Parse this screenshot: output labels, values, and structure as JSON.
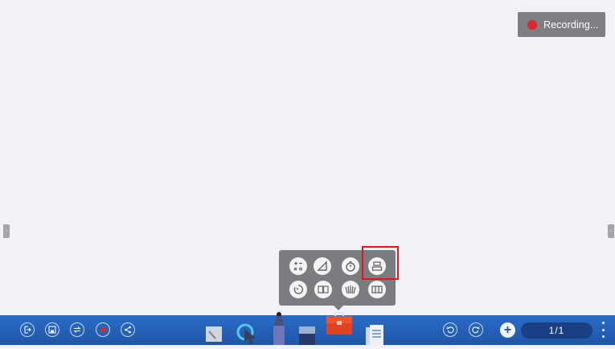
{
  "recording": {
    "label": "Recording..."
  },
  "side_tabs": {
    "left_glyph": "›",
    "right_glyph": "‹"
  },
  "toolbox": {
    "row1": [
      "calculator-icon",
      "triangle-ruler-icon",
      "stopwatch-icon",
      "align-icon"
    ],
    "row2": [
      "timer-icon",
      "flip-cards-icon",
      "fan-cards-icon",
      "columns-icon"
    ],
    "highlighted": "align-icon"
  },
  "taskbar": {
    "left_buttons": [
      "exit-icon",
      "save-icon",
      "switch-icon",
      "stop-record-icon",
      "share-icon"
    ],
    "center_tools": [
      "eraser-board-icon",
      "select-pointer-icon",
      "marker-pen-icon",
      "eraser-icon",
      "toolbox-icon",
      "documents-icon"
    ],
    "undo_icon": "undo-icon",
    "redo_icon": "redo-icon",
    "add_page_label": "+",
    "page_indicator": "1/1"
  },
  "colors": {
    "taskbar": "#1f56a9",
    "record_dot": "#e0252b",
    "highlight_box": "#e3161b",
    "popup": "#7a7c80"
  }
}
